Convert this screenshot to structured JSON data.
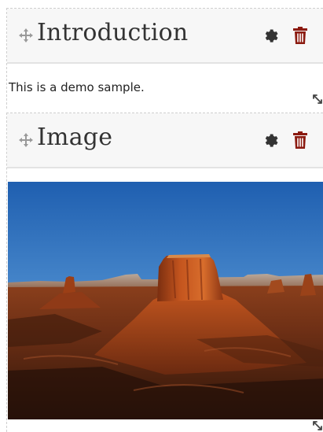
{
  "widgets": {
    "introduction": {
      "title": "Introduction",
      "body": "This is a demo sample.",
      "icons": {
        "move": "move-arrows-icon",
        "settings": "gear-icon",
        "delete": "trash-icon",
        "resize": "resize-handle-icon"
      }
    },
    "image": {
      "title": "Image",
      "image_subject": "desert-butte-landscape",
      "icons": {
        "move": "move-arrows-icon",
        "settings": "gear-icon",
        "delete": "trash-icon",
        "resize": "resize-handle-icon"
      }
    }
  },
  "colors": {
    "header_bg": "#f7f7f7",
    "title_text": "#333333",
    "gear": "#333333",
    "trash": "#8b1a10",
    "move_icon": "#9a9a9a",
    "dashed_border": "#cfcfcf"
  }
}
